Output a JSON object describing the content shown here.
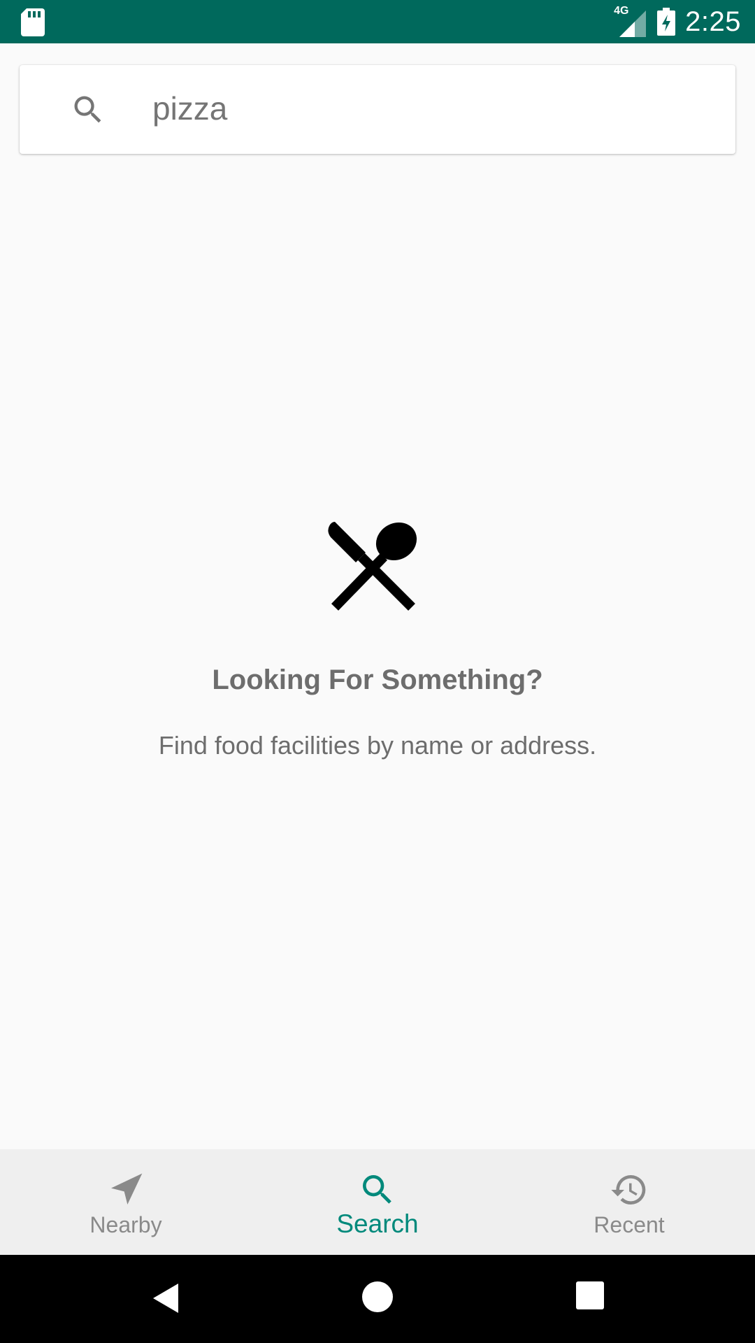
{
  "status_bar": {
    "time": "2:25",
    "network_label": "4G",
    "icons": [
      "sd-card-icon",
      "signal-icon",
      "battery-charging-icon"
    ],
    "background_color": "#00695c"
  },
  "search": {
    "value": "pizza",
    "icon": "search-icon"
  },
  "empty_state": {
    "icon": "restaurant-icon",
    "title": "Looking For Something?",
    "subtitle": "Find food facilities by name or address."
  },
  "bottom_nav": {
    "items": [
      {
        "label": "Nearby",
        "icon": "navigation-arrow-icon",
        "active": false
      },
      {
        "label": "Search",
        "icon": "search-icon",
        "active": true
      },
      {
        "label": "Recent",
        "icon": "history-icon",
        "active": false
      }
    ],
    "active_color": "#00897b",
    "inactive_color": "#8a8a8a"
  },
  "system_nav": {
    "buttons": [
      "back-icon",
      "home-icon",
      "recents-icon"
    ]
  }
}
